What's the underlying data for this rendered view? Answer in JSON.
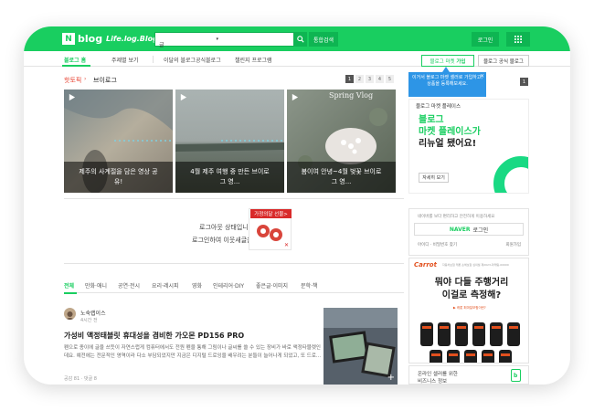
{
  "header": {
    "logo_n": "N",
    "logo_text": "blog",
    "tagline": "Life.log.Blog",
    "search_value": "글",
    "search_caret": "▾",
    "search_icon": "search-icon",
    "total_search_label": "통합검색",
    "login_label": "로그인",
    "apps_icon": "grid-icon"
  },
  "nav": {
    "items": [
      "블로그 홈",
      "주제별 보기",
      "이달의 블로그",
      "공식블로그",
      "챌린지 프로그램"
    ],
    "market_join_prefix": "블로그 마켓",
    "market_join_suffix": "가입",
    "official_blog": "블로그 공식 블로그"
  },
  "hot_topic": {
    "label": "핫토픽",
    "arrow": "›",
    "topic": "브이로그",
    "pages": [
      "1",
      "2",
      "3",
      "4",
      "5"
    ],
    "active_page": "1",
    "cards": [
      {
        "caption": "제주의 사계절을 담은 영상 공유!",
        "overlay": ""
      },
      {
        "caption": "4월 제주 여행 중 만든 브이로그 영...",
        "overlay": ""
      },
      {
        "caption": "봄이여 안녕~4월 벚꽃 브이로그 영...",
        "overlay": "Spring Vlog"
      }
    ]
  },
  "login_prompt": {
    "line1": "로그아웃 상태입니",
    "line2": "로그인하여 이웃새글을 확",
    "promo_badge": "가정의달 선물>",
    "promo_close": "✕"
  },
  "categories": {
    "items": [
      "전체",
      "만화·애니",
      "공연·전시",
      "요리·레시피",
      "영화",
      "인테리어·DIY",
      "좋은글·이미지",
      "문학·책"
    ],
    "active": "전체"
  },
  "post": {
    "author": "노숙랩이스",
    "time": "4시간 전",
    "title": "가성비 액정태블릿 휴대성을 겸비한 가오몬 PD156 PRO",
    "body": "펜으로 종이에 글을 쓰듯이 자연스럽게 컴퓨터에서도 전원 펜을 통해 그림이나 글씨를 쓸 수 있는 장비가 바로 액정타블렛인데요. 예전에는 전문적인 영역이라 다소 부담되었지만 지금은 디지털 드로잉을 배우려는 분들이 늘어나게 되었고, 또 드로...",
    "stats": "공감 81 · 댓글 8",
    "thumb_plus": "+"
  },
  "right": {
    "tooltip": "이거서 블로그 마켓 셀러로 가입하고, 상품을 등록해보세요.",
    "tooltip_close": "✕",
    "ad_page": "1",
    "ad_small": "블로그 마켓 플레이스",
    "ad_line1": "블로그",
    "ad_line2": "마켓 플레이스가",
    "ad_line3": "리뉴얼 됐어요!",
    "ad_detail": "자세히 보기",
    "login_hint": "네이버를 보다 편리하고 안전하게 이용하세요",
    "naver_n": "NAVER",
    "naver_login": "로그인",
    "find_links": "아이디 · 비밀번호 찾기",
    "join": "회원가입",
    "carrot_brand": "Carrot",
    "carrot_tiny": "자동차보험 캐롯 손해보험 심의필 제2023-마케팅-00000",
    "carrot_q1": "뭐야 다들 주행거리",
    "carrot_q2": "이걸로 측정해?",
    "carrot_sub": "▶ 캐롯 퍼마일보험이란?",
    "online_line1": "온라인 셀러를 위한",
    "online_line2": "비즈니스 정보",
    "online_icon": "shopping-bag-icon",
    "accent": "#19ce60",
    "tooltip_color": "#2d95e6"
  }
}
